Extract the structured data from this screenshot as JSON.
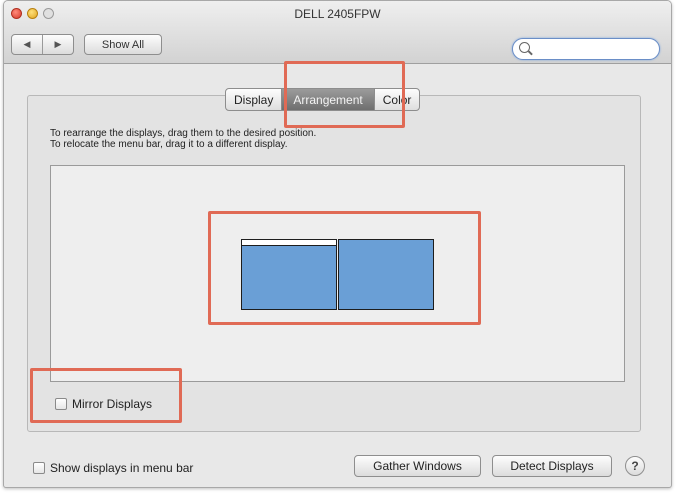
{
  "window": {
    "title": "DELL 2405FPW"
  },
  "toolbar": {
    "back_glyph": "◀",
    "forward_glyph": "▶",
    "show_all_label": "Show All",
    "search_placeholder": ""
  },
  "tabs": [
    {
      "label": "Display",
      "active": false
    },
    {
      "label": "Arrangement",
      "active": true
    },
    {
      "label": "Color",
      "active": false
    }
  ],
  "instructions": {
    "line1": "To rearrange the displays, drag them to the desired position.",
    "line2": "To relocate the menu bar, drag it to a different display."
  },
  "arrangement": {
    "displays": [
      {
        "name": "main-display",
        "has_menu_bar": true
      },
      {
        "name": "secondary-display",
        "has_menu_bar": false
      }
    ],
    "display_color": "#6a9fd6"
  },
  "mirror_displays": {
    "label": "Mirror Displays",
    "checked": false
  },
  "show_in_menu_bar": {
    "label": "Show displays in menu bar",
    "checked": false
  },
  "buttons": {
    "gather_windows": "Gather Windows",
    "detect_displays": "Detect Displays",
    "help": "?"
  },
  "annotation_color": "#e06a55"
}
